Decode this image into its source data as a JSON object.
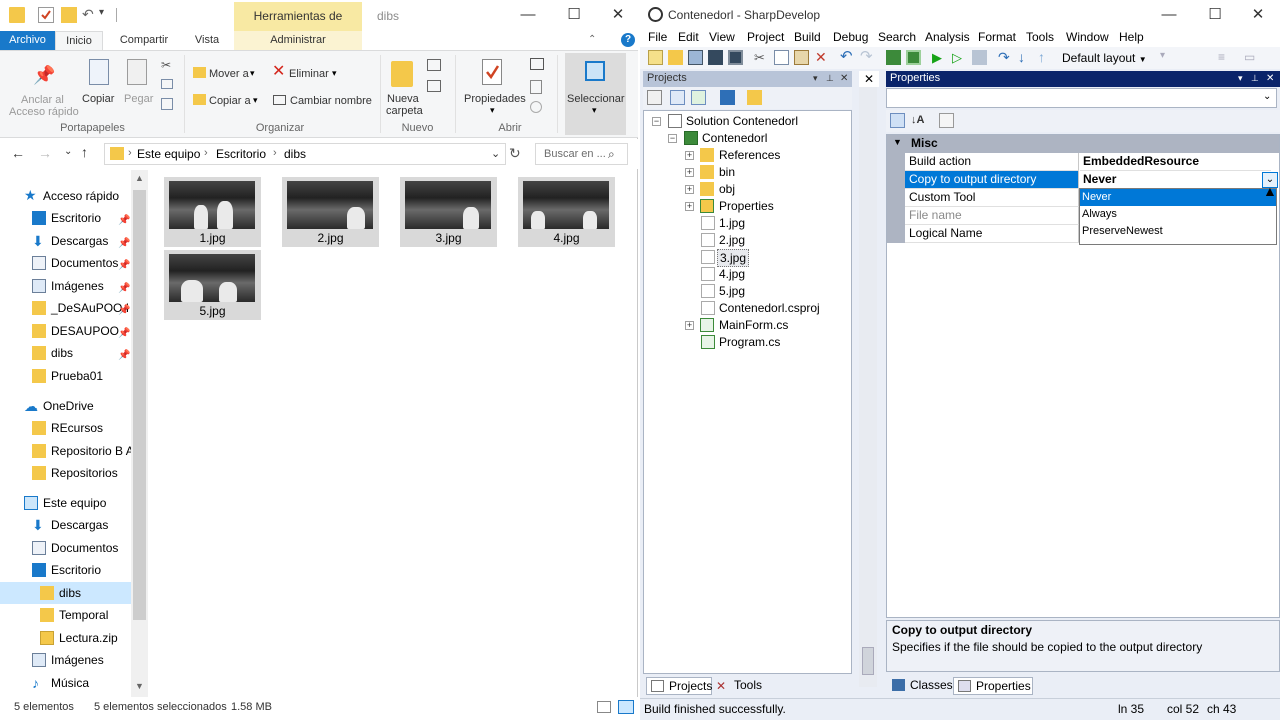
{
  "explorer": {
    "context_tab": "Herramientas de imagen",
    "window_title": "dibs",
    "tabs": {
      "file": "Archivo",
      "home": "Inicio",
      "share": "Compartir",
      "view": "Vista",
      "manage": "Administrar"
    },
    "ribbon": {
      "pin_label_1": "Anclar al",
      "pin_label_2": "Acceso rápido",
      "copy": "Copiar",
      "paste": "Pegar",
      "clipboard_group": "Portapapeles",
      "move_to": "Mover a",
      "copy_to": "Copiar a",
      "delete": "Eliminar",
      "rename": "Cambiar nombre",
      "organize_group": "Organizar",
      "new_folder_1": "Nueva",
      "new_folder_2": "carpeta",
      "new_group": "Nuevo",
      "properties": "Propiedades",
      "open_group": "Abrir",
      "select": "Seleccionar"
    },
    "breadcrumb": [
      "Este equipo",
      "Escritorio",
      "dibs"
    ],
    "search_placeholder": "Buscar en ...",
    "nav": {
      "quick_access": "Acceso rápido",
      "qa_items": [
        "Escritorio",
        "Descargas",
        "Documentos",
        "Imágenes",
        "_DeSAuPOO I",
        "DESAUPOO",
        "dibs",
        "Prueba01"
      ],
      "onedrive": "OneDrive",
      "od_items": [
        "REcursos",
        "Repositorio B Ag",
        "Repositorios"
      ],
      "this_pc": "Este equipo",
      "pc_items": [
        "Descargas",
        "Documentos",
        "Escritorio",
        "dibs",
        "Temporal",
        "Lectura.zip",
        "Imágenes",
        "Música"
      ]
    },
    "files": [
      "1.jpg",
      "2.jpg",
      "3.jpg",
      "4.jpg",
      "5.jpg"
    ],
    "status": {
      "count": "5 elementos",
      "selected": "5 elementos seleccionados",
      "size": "1.58 MB"
    }
  },
  "sharpdevelop": {
    "title": "Contenedorl - SharpDevelop",
    "menu": [
      "File",
      "Edit",
      "View",
      "Project",
      "Build",
      "Debug",
      "Search",
      "Analysis",
      "Format",
      "Tools",
      "Window",
      "Help"
    ],
    "layout": "Default layout",
    "projects_panel": "Projects",
    "properties_panel": "Properties",
    "tree": {
      "solution": "Solution Contenedorl",
      "project": "Contenedorl",
      "items": [
        "References",
        "bin",
        "obj",
        "Properties",
        "1.jpg",
        "2.jpg",
        "3.jpg",
        "4.jpg",
        "5.jpg",
        "Contenedorl.csproj",
        "MainForm.cs",
        "Program.cs"
      ]
    },
    "bottom_tabs_left": [
      "Projects",
      "Tools"
    ],
    "bottom_tabs_right": [
      "Classes",
      "Properties"
    ],
    "properties": {
      "category": "Misc",
      "rows": [
        {
          "name": "Build action",
          "value": "EmbeddedResource"
        },
        {
          "name": "Copy to output directory",
          "value": "Never"
        },
        {
          "name": "Custom Tool",
          "value": ""
        },
        {
          "name": "File name",
          "value": ""
        },
        {
          "name": "Logical Name",
          "value": ""
        }
      ],
      "dropdown_options": [
        "Never",
        "Always",
        "PreserveNewest"
      ],
      "help_title": "Copy to output directory",
      "help_text": "Specifies if the file should be copied to the output directory"
    },
    "status": {
      "message": "Build finished successfully.",
      "line": "ln 35",
      "col": "col 52",
      "ch": "ch 43"
    }
  },
  "colors": {
    "accent": "#1979ca",
    "selection": "#0078d7",
    "panel_header": "#0a246a",
    "folder": "#f4c84a"
  }
}
